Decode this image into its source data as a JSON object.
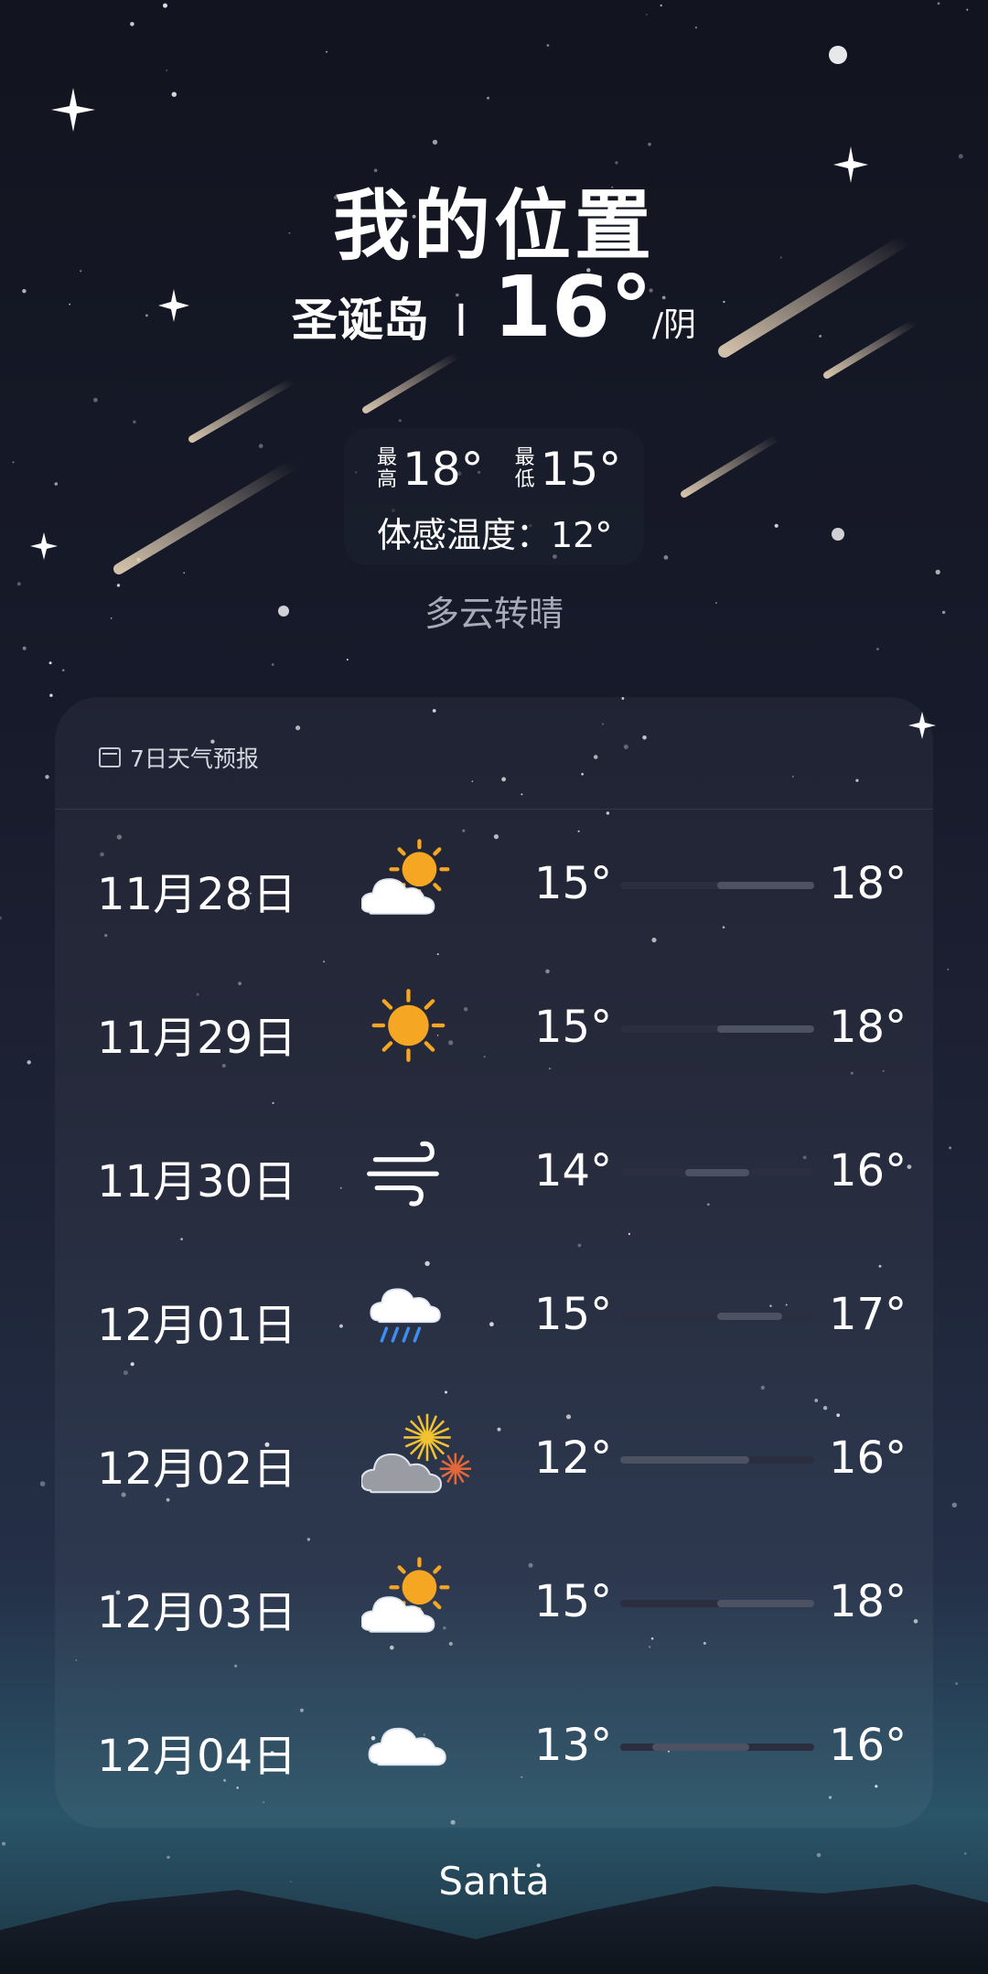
{
  "header": {
    "title": "我的位置",
    "location": "圣诞岛",
    "separator": "I",
    "temperature": "16°",
    "condition": "/阴"
  },
  "today": {
    "high_label_1": "最",
    "high_label_2": "高",
    "high": "18°",
    "low_label_1": "最",
    "low_label_2": "低",
    "low": "15°",
    "feels_like": "体感温度：12°",
    "description": "多云转晴"
  },
  "forecast": {
    "title": "7日天气预报",
    "days": [
      {
        "date": "11月28日",
        "icon": "partly-cloudy-icon",
        "low": "15°",
        "high": "18°"
      },
      {
        "date": "11月29日",
        "icon": "sunny-icon",
        "low": "15°",
        "high": "18°"
      },
      {
        "date": "11月30日",
        "icon": "windy-icon",
        "low": "14°",
        "high": "16°"
      },
      {
        "date": "12月01日",
        "icon": "rain-icon",
        "low": "15°",
        "high": "17°"
      },
      {
        "date": "12月02日",
        "icon": "fireworks-cloud-icon",
        "low": "12°",
        "high": "16°"
      },
      {
        "date": "12月03日",
        "icon": "partly-cloudy-icon",
        "low": "15°",
        "high": "18°"
      },
      {
        "date": "12月04日",
        "icon": "cloudy-icon",
        "low": "13°",
        "high": "16°"
      }
    ]
  },
  "footer": {
    "text": "Santa"
  }
}
